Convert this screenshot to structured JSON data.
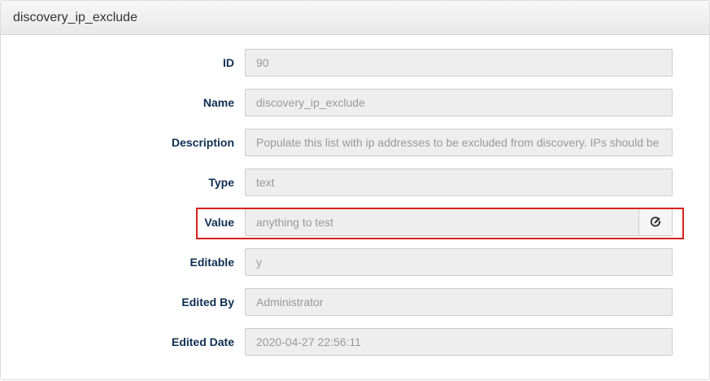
{
  "panel": {
    "title": "discovery_ip_exclude"
  },
  "fields": [
    {
      "label": "ID",
      "value": "90"
    },
    {
      "label": "Name",
      "value": "discovery_ip_exclude"
    },
    {
      "label": "Description",
      "value": "Populate this list with ip addresses to be excluded from discovery. IPs should be"
    },
    {
      "label": "Type",
      "value": "text"
    },
    {
      "label": "Value",
      "value": "anything to test",
      "addon_icon": "edit-icon"
    },
    {
      "label": "Editable",
      "value": "y"
    },
    {
      "label": "Edited By",
      "value": "Administrator"
    },
    {
      "label": "Edited Date",
      "value": "2020-04-27 22:56:11"
    }
  ],
  "colors": {
    "label": "#0f2f52",
    "input_text": "#999999",
    "input_bg": "#eeeeee",
    "highlight": "#d9201d"
  }
}
